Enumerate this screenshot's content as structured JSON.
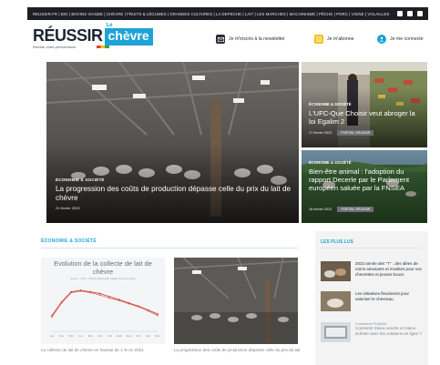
{
  "topbar": {
    "links": "REUSSIR.FR | BIO | BOVINS VIANDE | CHÈVRE | FRUITS & LÉGUMES | GRANDES CULTURES | LA DEPECHE | LAIT | LES MARCHÉS | MACHINISME | PÊCHE | PORC | VIGNE | VOLAILLES",
    "social_icons": [
      "facebook-icon",
      "twitter-icon",
      "instagram-icon"
    ]
  },
  "header": {
    "logo_reussir": "RÉUSSIR",
    "logo_le": "Le",
    "logo_chevre": "chèvre",
    "tagline": "Réussir votre performance",
    "newsletter": "Je m'inscris à la newsletter",
    "subscribe": "Je m'abonne",
    "login": "Je me connecte"
  },
  "hero": {
    "main": {
      "kicker": "ÉCONOMIE & SOCIÉTÉ",
      "title": "La progression des coûts de production dépasse celle du prix du lait de chèvre",
      "date": "21 février 2022"
    },
    "side1": {
      "kicker": "ÉCONOMIE & SOCIÉTÉ",
      "title": "L'UFC-Que Choisir veut abroger la loi Egalim 2",
      "date": "17 février 2022",
      "tag": "PORTAIL RÉUSSIR"
    },
    "side2": {
      "kicker": "ÉCONOMIE & SOCIÉTÉ",
      "title": "Bien-être animal : l'adoption du rapport Decerle par le Parlement européen saluée par la FNSEA",
      "date": "16 février 2022",
      "tag": "PORTAIL RÉUSSIR"
    }
  },
  "section": {
    "title": "ÉCONOMIE & SOCIÉTÉ",
    "cards": [
      {
        "caption": "La collecte de lait de chèvre en hausse de 1 % en 2021",
        "chart_title": "Evolution de la collecte de lait de chèvre",
        "chart_source": "Source : SSP - Collecte Mensuelle Laitière France entière"
      },
      {
        "caption": "La progression des coûts de production dépasse celle du prix du lait"
      }
    ]
  },
  "chart_data": {
    "type": "line",
    "title": "Evolution de la collecte de lait de chèvre",
    "x": [
      "Jan",
      "Fév",
      "Mar",
      "Avr",
      "Mai",
      "Juin",
      "Juil",
      "Août",
      "Sept",
      "Oct",
      "Nov",
      "Déc"
    ],
    "series": [
      {
        "values": [
          18,
          36,
          49,
          51,
          49,
          46,
          42,
          39,
          35,
          31,
          26,
          20
        ]
      },
      {
        "values": [
          20,
          37,
          50,
          52,
          50,
          48,
          44,
          40,
          36,
          32,
          27,
          22
        ]
      }
    ],
    "ylim": [
      0,
      60
    ],
    "grid": false,
    "colors": [
      "#e27a6f",
      "#c94b3f"
    ]
  },
  "popular": {
    "title": "LES PLUS LUS",
    "items": [
      {
        "title": "2022 année des \"T\" : des idées de noms amusants et insolites pour vos chevrettes et jeunes boucs"
      },
      {
        "title": "Les initiatives fleurissent pour valoriser le chevreau."
      },
      {
        "kicker": "Commerce-Publicité",
        "title": "Comment mieux vendre et mieux acheter avec les cotations en ligne ?"
      }
    ]
  },
  "colors": {
    "accent": "#1fa3d6",
    "dark": "#1c1f24",
    "newsletter_icon": "#2a2f35",
    "subscribe_icon": "#f3c21a",
    "login_icon": "#1fa3d6"
  }
}
